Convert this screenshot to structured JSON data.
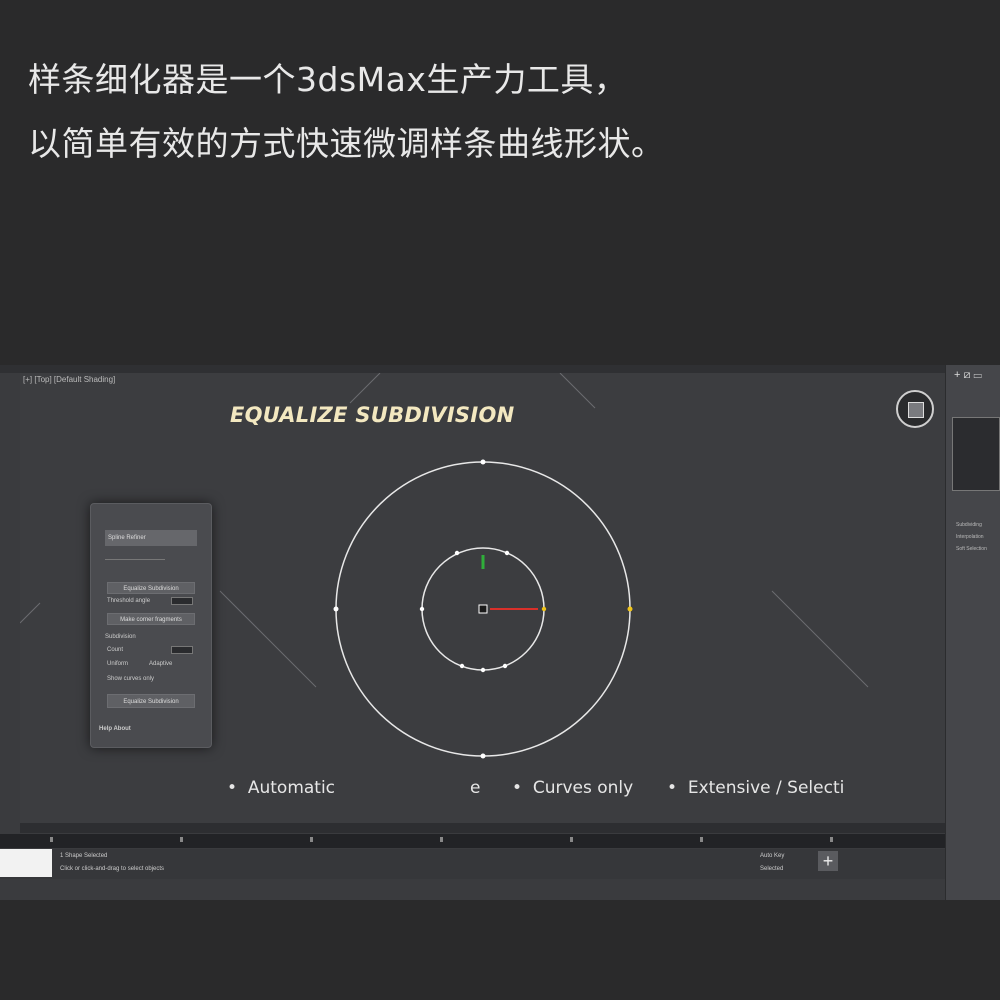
{
  "caption": {
    "line1": "样条细化器是一个3dsMax生产力工具，",
    "line2": "以简单有效的方式快速微调样条曲线形状。"
  },
  "viewport": {
    "label": "[+] [Top] [Default Shading]",
    "title": "EQUALIZE SUBDIVISION"
  },
  "panel": {
    "header": "Spline Refiner",
    "rows": [
      "Equalize Subdivision",
      "Threshold angle",
      "Make corner fragments"
    ],
    "section": "Subdivision",
    "count_label": "Count",
    "options": [
      "Uniform",
      "Adaptive"
    ],
    "checkbox": "Show curves only",
    "apply": "Equalize Subdivision",
    "footer": "Help About"
  },
  "bullets": [
    "Automatic",
    "e",
    "Curves only",
    "Extensive / Selecti"
  ],
  "rightpanel": {
    "icons": "+ ⧄ ▭",
    "items": [
      "Subdividing",
      "Interpolation",
      "Soft Selection"
    ]
  },
  "statusbar": {
    "line1": "1 Shape Selected",
    "line2": "Click or click-and-drag to select objects",
    "auto_label": "Auto Key",
    "selected_label": "Selected"
  },
  "colors": {
    "background": "#2a2a2b",
    "viewport": "#3c3d40",
    "title": "#f3e8c0",
    "spline": "#e8e8e8",
    "vertex_yellow": "#f0c419",
    "gizmo_red": "#d9302a",
    "gizmo_green": "#2fae3a"
  }
}
